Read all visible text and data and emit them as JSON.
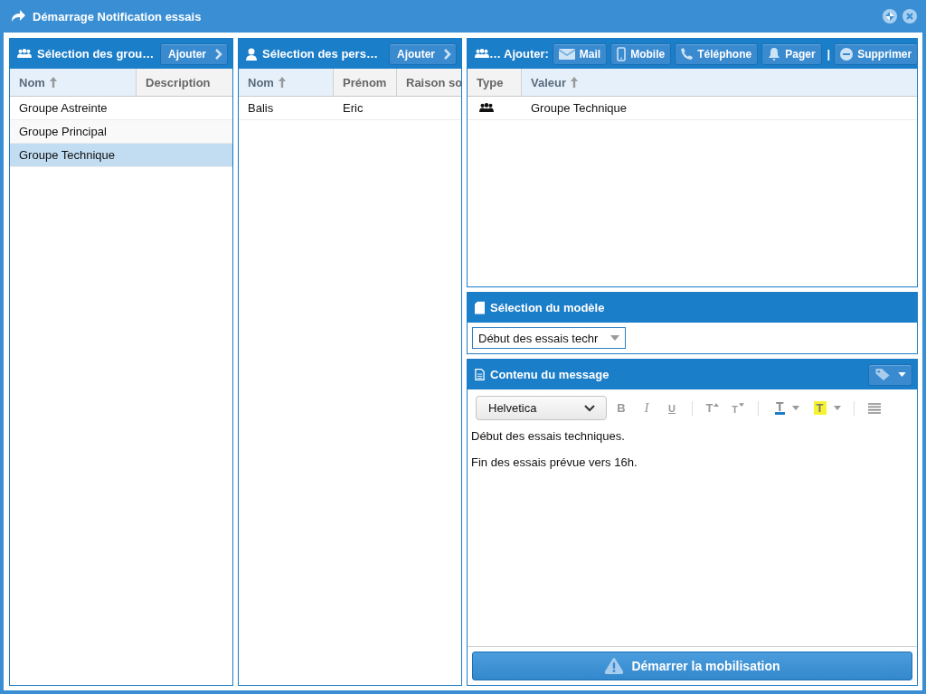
{
  "window": {
    "title": "Démarrage Notification essais"
  },
  "groups_panel": {
    "title": "Sélection des grou…",
    "add_button": "Ajouter",
    "columns": [
      {
        "label": "Nom",
        "sorted": true
      },
      {
        "label": "Description",
        "sorted": false
      }
    ],
    "rows": [
      {
        "cells": [
          "Groupe Astreinte"
        ],
        "selected": false
      },
      {
        "cells": [
          "Groupe Principal"
        ],
        "selected": false
      },
      {
        "cells": [
          "Groupe Technique"
        ],
        "selected": true
      }
    ]
  },
  "persons_panel": {
    "title": "Sélection des pers…",
    "add_button": "Ajouter",
    "columns": [
      {
        "label": "Nom",
        "sorted": true
      },
      {
        "label": "Prénom",
        "sorted": false
      },
      {
        "label": "Raison so",
        "sorted": false
      }
    ],
    "rows": [
      {
        "cells": [
          "Balis",
          "Eric"
        ],
        "selected": false
      }
    ]
  },
  "recipients_panel": {
    "title": "…",
    "add_label": "Ajouter:",
    "buttons": [
      {
        "kind": "mail",
        "label": "Mail"
      },
      {
        "kind": "mobile",
        "label": "Mobile"
      },
      {
        "kind": "phone",
        "label": "Téléphone"
      },
      {
        "kind": "pager",
        "label": "Pager"
      }
    ],
    "separator": "|",
    "delete_button": "Supprimer",
    "columns": [
      {
        "label": "Type",
        "sorted": false
      },
      {
        "label": "Valeur",
        "sorted": true
      }
    ],
    "rows": [
      {
        "kind": "group",
        "value": "Groupe Technique"
      }
    ]
  },
  "model_panel": {
    "title": "Sélection du modèle",
    "select": "Début des essais techr"
  },
  "message_panel": {
    "title": "Contenu du message",
    "font": "Helvetica",
    "toolbar": [
      {
        "kind": "bold",
        "glyph": "B"
      },
      {
        "kind": "italic",
        "glyph": "I"
      },
      {
        "kind": "underline",
        "glyph": "U"
      },
      {
        "kind": "sep"
      },
      {
        "kind": "grow",
        "glyph": "T"
      },
      {
        "kind": "shrink",
        "glyph": "T"
      },
      {
        "kind": "sep"
      },
      {
        "kind": "color",
        "glyph": "T"
      },
      {
        "kind": "highlight",
        "glyph": "T"
      },
      {
        "kind": "sep"
      },
      {
        "kind": "align"
      }
    ],
    "paragraphs": [
      "Début des essais techniques.",
      "Fin des essais prévue vers 16h."
    ]
  },
  "start_button": "Démarrer la mobilisation"
}
